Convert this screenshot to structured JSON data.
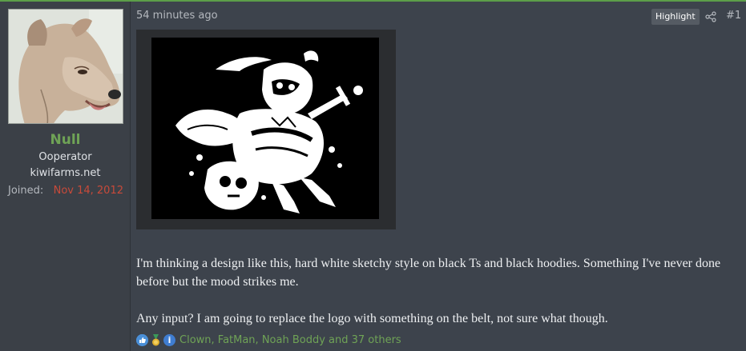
{
  "user": {
    "name": "Null",
    "title": "Ooperator",
    "site": "kiwifarms.net",
    "joined_label": "Joined:",
    "joined_value": "Nov 14, 2012"
  },
  "post": {
    "timestamp": "54 minutes ago",
    "highlight_label": "Highlight",
    "post_number": "#1",
    "paragraph_1": "I'm thinking a design like this, hard white sketchy style on black Ts and black hoodies. Something I've never done before but the mood strikes me.",
    "paragraph_2": "Any input? I am going to replace the logo with something on the belt, not sure what though.",
    "reactions_text": "Clown, FatMan, Noah Boddy and 37 others",
    "reaction_icons": [
      "like-icon",
      "medal-icon",
      "info-icon"
    ]
  },
  "colors": {
    "accent_green": "#6fa356",
    "joined_red": "#c84a3a",
    "background": "#3d434c"
  }
}
